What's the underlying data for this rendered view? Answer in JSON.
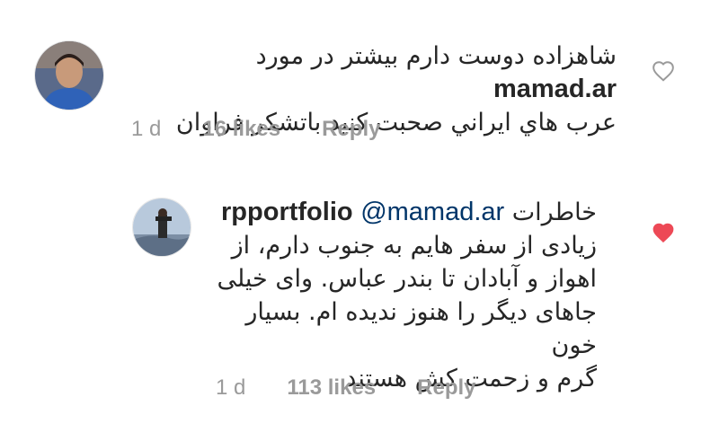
{
  "comments": [
    {
      "username": "mamad.ar",
      "text_line1": "شاهزاده دوست دارم بيشتر در مورد",
      "text_line2": "عرب هاي ايراني صحبت كنيد.باتشكر فراوان",
      "time": "1 d",
      "likes": "16 likes",
      "reply": "Reply",
      "liked": false,
      "heart_icon": "heart-outline-icon"
    },
    {
      "username": "rpportfolio",
      "mention": "@mamad.ar",
      "text_line1_rest": "خاطرات",
      "text_line2": "زیادی از سفر هایم به جنوب دارم، از",
      "text_line3": "اهواز و آبادان تا بندر عباس. وای خیلی",
      "text_line4": "جاهای دیگر را هنوز ندیده ام. بسیار خون",
      "text_line5": "گرم و زحمت کش هستند",
      "time": "1 d",
      "likes": "113 likes",
      "reply": "Reply",
      "liked": true,
      "heart_icon": "heart-filled-icon"
    }
  ],
  "colors": {
    "heart_liked": "#ed4956",
    "heart_outline": "#9a9a9a",
    "meta_text": "#9a9a9a",
    "mention": "#003569"
  }
}
